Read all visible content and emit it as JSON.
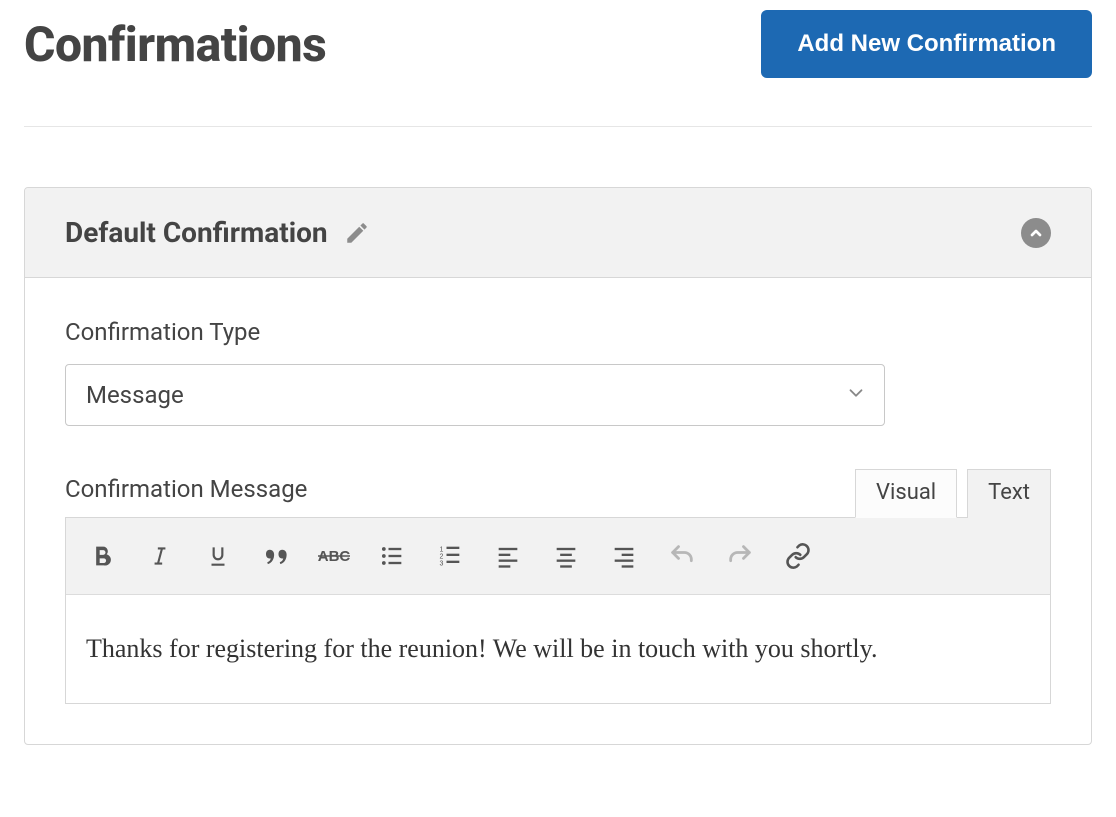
{
  "header": {
    "title": "Confirmations",
    "add_button_label": "Add New Confirmation"
  },
  "panel": {
    "title": "Default Confirmation",
    "icons": {
      "edit": "pencil-icon",
      "collapse": "chevron-up-icon"
    }
  },
  "form": {
    "type_label": "Confirmation Type",
    "type_value": "Message",
    "message_label": "Confirmation Message"
  },
  "editor": {
    "tabs": {
      "visual": "Visual",
      "text": "Text",
      "active": "visual"
    },
    "toolbar": {
      "bold": "bold-icon",
      "italic": "italic-icon",
      "underline": "underline-icon",
      "blockquote": "blockquote-icon",
      "strikethrough": "strikethrough-icon",
      "bullet_list": "bullet-list-icon",
      "number_list": "numbered-list-icon",
      "align_left": "align-left-icon",
      "align_center": "align-center-icon",
      "align_right": "align-right-icon",
      "undo": "undo-icon",
      "redo": "redo-icon",
      "link": "link-icon"
    },
    "content": "Thanks for registering for the reunion! We will be in touch with you shortly."
  }
}
